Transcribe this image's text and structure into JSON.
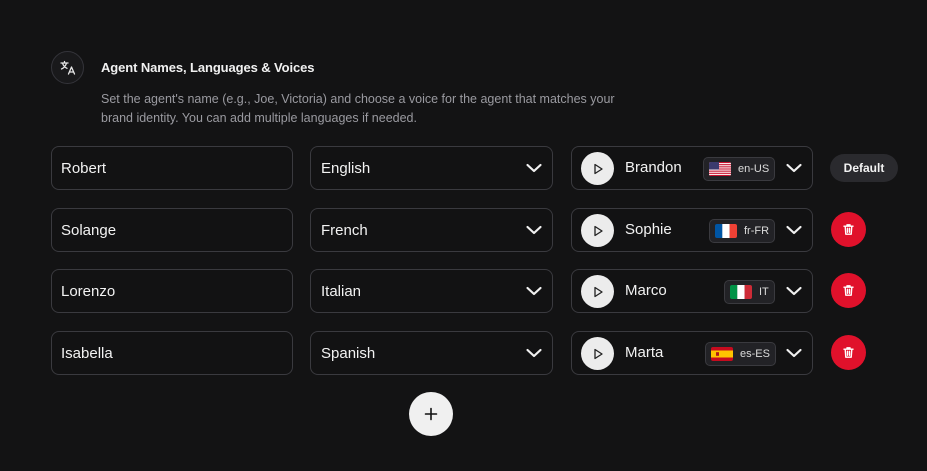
{
  "section": {
    "icon": "translate-icon",
    "title": "Agent Names, Languages & Voices",
    "description": "Set the agent's name (e.g., Joe, Victoria) and choose a voice for the agent that matches your brand identity. You can add multiple languages if needed."
  },
  "agents": [
    {
      "name": "Robert",
      "language": "English",
      "voice": "Brandon",
      "locale": "en-US",
      "flag": "us-flag-icon",
      "action": "Default"
    },
    {
      "name": "Solange",
      "language": "French",
      "voice": "Sophie",
      "locale": "fr-FR",
      "flag": "fr-flag-icon",
      "action": "delete"
    },
    {
      "name": "Lorenzo",
      "language": "Italian",
      "voice": "Marco",
      "locale": "IT",
      "flag": "it-flag-icon",
      "action": "delete"
    },
    {
      "name": "Isabella",
      "language": "Spanish",
      "voice": "Marta",
      "locale": "es-ES",
      "flag": "es-flag-icon",
      "action": "delete"
    }
  ],
  "colors": {
    "background": "#131314",
    "delete": "#e0112b",
    "default_pill": "#2a2a2e"
  }
}
